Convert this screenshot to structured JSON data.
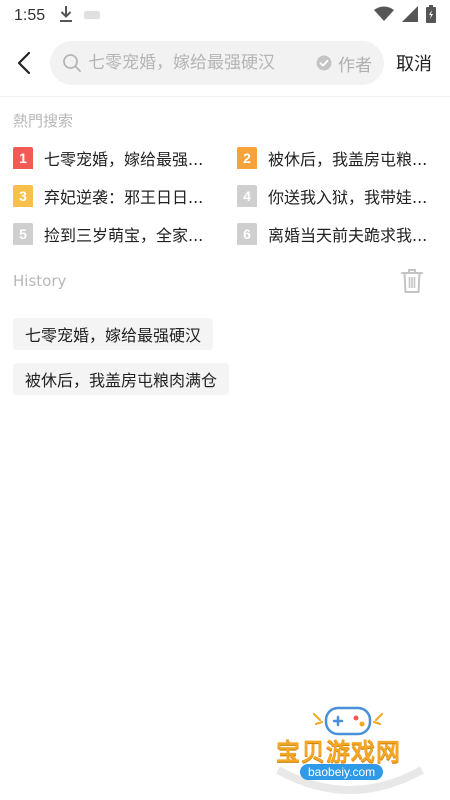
{
  "status_bar": {
    "time": "1:55"
  },
  "header": {
    "search_placeholder": "七零宠婚，嫁给最强硬汉",
    "author_label": "作者",
    "cancel_label": "取消"
  },
  "hot_search": {
    "title": "熱門搜索",
    "items": [
      {
        "rank": "1",
        "text": "七零宠婚，嫁给最强...",
        "color": "#f25b55"
      },
      {
        "rank": "2",
        "text": "被休后，我盖房屯粮...",
        "color": "#f5a33a"
      },
      {
        "rank": "3",
        "text": "弃妃逆袭：邪王日日...",
        "color": "#f7c04a"
      },
      {
        "rank": "4",
        "text": "你送我入狱，我带娃...",
        "color": "#cfcfcf"
      },
      {
        "rank": "5",
        "text": "捡到三岁萌宝，全家...",
        "color": "#cfcfcf"
      },
      {
        "rank": "6",
        "text": "离婚当天前夫跪求我...",
        "color": "#cfcfcf"
      }
    ]
  },
  "history": {
    "title": "History",
    "items": [
      {
        "text": "七零宠婚，嫁给最强硬汉"
      },
      {
        "text": "被休后，我盖房屯粮肉满仓"
      }
    ]
  },
  "watermark": {
    "title": "宝贝游戏网",
    "url": "baobeiy.com"
  }
}
